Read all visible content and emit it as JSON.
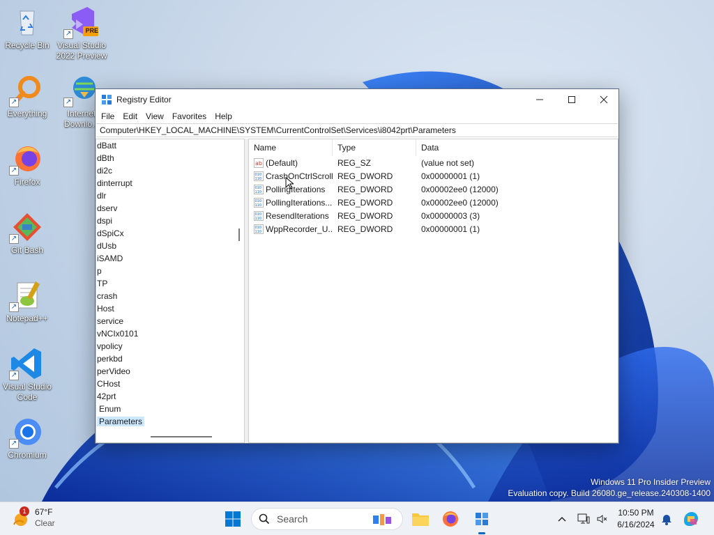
{
  "desktop": {
    "icons": [
      {
        "label": "Recycle Bin"
      },
      {
        "label": "Visual Studio 2022 Preview",
        "badge": "PRE"
      },
      {
        "label": "Everything"
      },
      {
        "label": "Internet Downlo..."
      },
      {
        "label": "Firefox"
      },
      {
        "label": "Git Bash"
      },
      {
        "label": "Notepad++"
      },
      {
        "label": "Visual Studio Code"
      },
      {
        "label": "Chromium"
      }
    ],
    "watermark": {
      "line1": "Windows 11 Pro Insider Preview",
      "line2": "Evaluation copy. Build 26080.ge_release.240308-1400"
    }
  },
  "window": {
    "title": "Registry Editor",
    "menu": [
      "File",
      "Edit",
      "View",
      "Favorites",
      "Help"
    ],
    "address": "Computer\\HKEY_LOCAL_MACHINE\\SYSTEM\\CurrentControlSet\\Services\\i8042prt\\Parameters",
    "tree_items": [
      "dBatt",
      "dBth",
      "di2c",
      "dinterrupt",
      "dlr",
      "dserv",
      "dspi",
      "dSpiCx",
      "dUsb",
      "iSAMD",
      "p",
      "TP",
      "crash",
      "Host",
      "service",
      "vNCIx0101",
      "vpolicy",
      "perkbd",
      "perVideo",
      "CHost",
      "42prt",
      "Enum",
      "Parameters"
    ],
    "selected_tree_item": "Parameters",
    "columns": {
      "name": "Name",
      "type": "Type",
      "data": "Data"
    },
    "values": [
      {
        "name": "(Default)",
        "type": "REG_SZ",
        "data": "(value not set)",
        "icon": "string-value-icon"
      },
      {
        "name": "CrashOnCtrlScroll",
        "type": "REG_DWORD",
        "data": "0x00000001 (1)",
        "icon": "binary-value-icon"
      },
      {
        "name": "PollingIterations",
        "type": "REG_DWORD",
        "data": "0x00002ee0 (12000)",
        "icon": "binary-value-icon"
      },
      {
        "name": "PollingIterations...",
        "type": "REG_DWORD",
        "data": "0x00002ee0 (12000)",
        "icon": "binary-value-icon"
      },
      {
        "name": "ResendIterations",
        "type": "REG_DWORD",
        "data": "0x00000003 (3)",
        "icon": "binary-value-icon"
      },
      {
        "name": "WppRecorder_U...",
        "type": "REG_DWORD",
        "data": "0x00000001 (1)",
        "icon": "binary-value-icon"
      }
    ]
  },
  "taskbar": {
    "weather": {
      "temp": "67°F",
      "condition": "Clear",
      "badge": "1"
    },
    "search_placeholder": "Search",
    "time": "10:50 PM",
    "date": "6/16/2024"
  },
  "colors": {
    "accent": "#0067c0",
    "selection": "#cce8ff",
    "wallpaper_bloom": "#1d4fd8"
  }
}
